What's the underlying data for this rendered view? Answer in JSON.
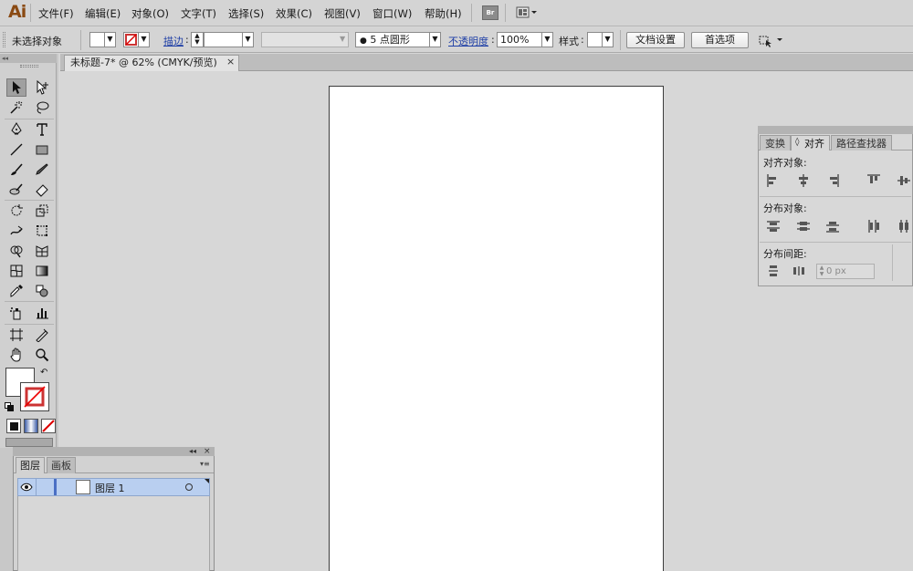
{
  "app": {
    "logo": "Ai"
  },
  "menu": {
    "items": [
      "文件(F)",
      "编辑(E)",
      "对象(O)",
      "文字(T)",
      "选择(S)",
      "效果(C)",
      "视图(V)",
      "窗口(W)",
      "帮助(H)"
    ],
    "bridge_label": "Br"
  },
  "control": {
    "selection": "未选择对象",
    "stroke_label": "描边",
    "brush_value": "5 点圆形",
    "opacity_label": "不透明度",
    "opacity_value": "100%",
    "style_label": "样式",
    "doc_setup": "文档设置",
    "prefs": "首选项"
  },
  "document": {
    "tab_title": "未标题-7* @ 62% (CMYK/预览)"
  },
  "align_panel": {
    "tabs": [
      "变换",
      "对齐",
      "路径查找器"
    ],
    "align_objects": "对齐对象:",
    "distribute_objects": "分布对象:",
    "distribute_spacing": "分布间距:",
    "spacing_value": "0 px"
  },
  "layers_panel": {
    "tabs": [
      "图层",
      "画板"
    ],
    "layer_name": "图层 1"
  },
  "colors": {
    "accent_link": "#1f3fa6",
    "layer_highlight": "#b9cff0",
    "logo": "#8a4a13"
  }
}
